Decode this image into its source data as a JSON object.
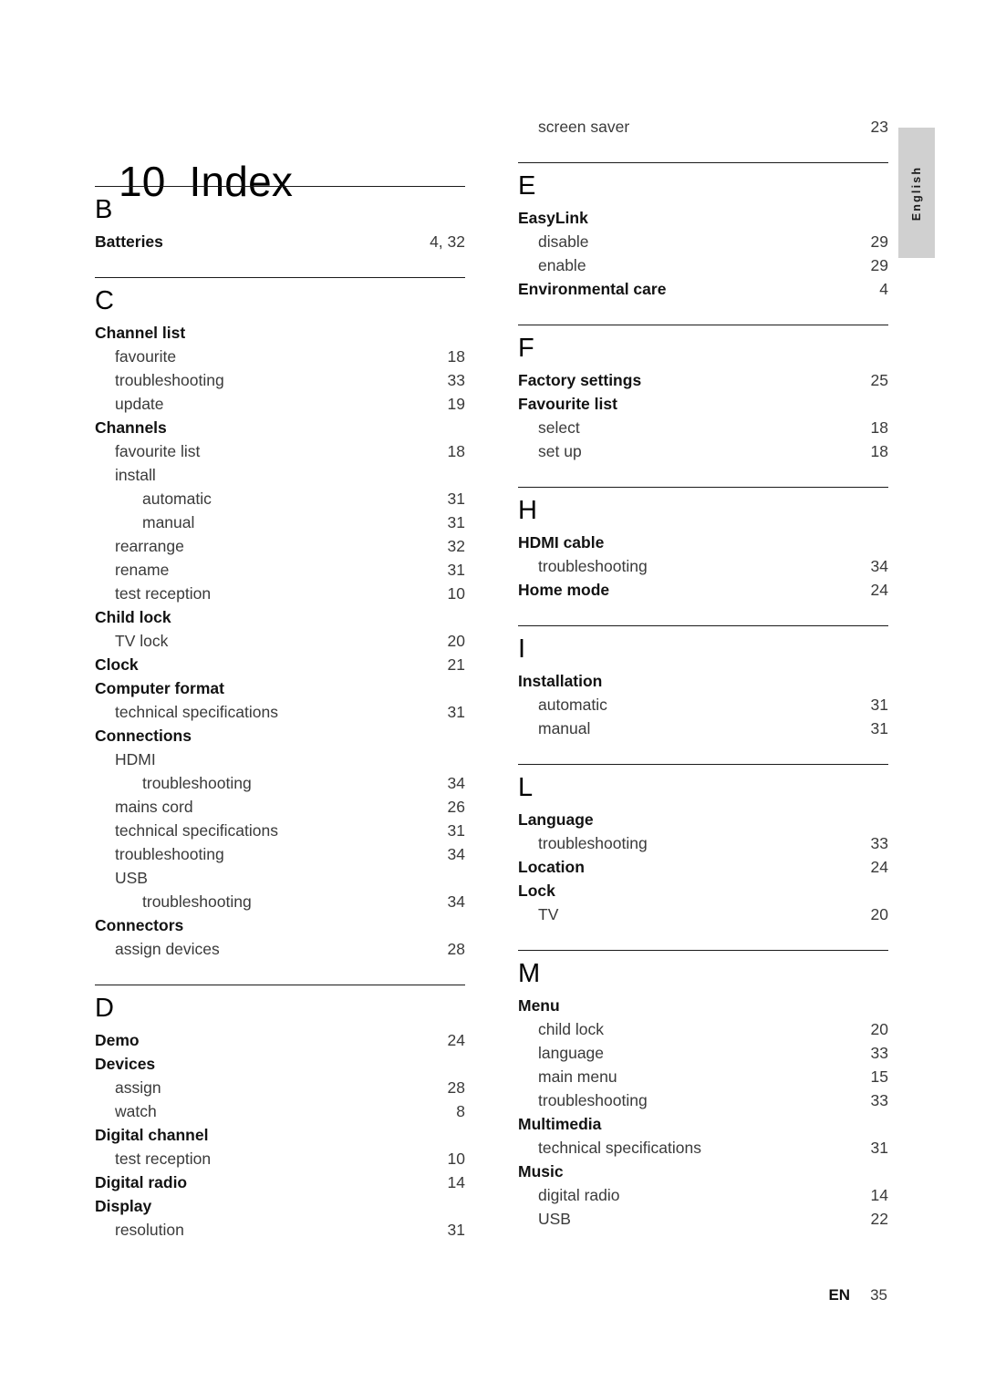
{
  "title": {
    "number": "10",
    "text": "Index"
  },
  "side_tab": {
    "label": "English"
  },
  "footer": {
    "language_code": "EN",
    "page_number": "35"
  },
  "columns": [
    {
      "name": "left-column",
      "sections": [
        {
          "letter": "B",
          "entries": [
            {
              "label": "Batteries",
              "page": "4, 32",
              "level": 0
            }
          ]
        },
        {
          "letter": "C",
          "entries": [
            {
              "label": "Channel list",
              "page": "",
              "level": 0
            },
            {
              "label": "favourite",
              "page": "18",
              "level": 1
            },
            {
              "label": "troubleshooting",
              "page": "33",
              "level": 1
            },
            {
              "label": "update",
              "page": "19",
              "level": 1
            },
            {
              "label": "Channels",
              "page": "",
              "level": 0
            },
            {
              "label": "favourite list",
              "page": "18",
              "level": 1
            },
            {
              "label": "install",
              "page": "",
              "level": 1
            },
            {
              "label": "automatic",
              "page": "31",
              "level": 2
            },
            {
              "label": "manual",
              "page": "31",
              "level": 2
            },
            {
              "label": "rearrange",
              "page": "32",
              "level": 1
            },
            {
              "label": "rename",
              "page": "31",
              "level": 1
            },
            {
              "label": "test reception",
              "page": "10",
              "level": 1
            },
            {
              "label": "Child lock",
              "page": "",
              "level": 0
            },
            {
              "label": "TV lock",
              "page": "20",
              "level": 1
            },
            {
              "label": "Clock",
              "page": "21",
              "level": 0
            },
            {
              "label": "Computer format",
              "page": "",
              "level": 0
            },
            {
              "label": "technical specifications",
              "page": "31",
              "level": 1
            },
            {
              "label": "Connections",
              "page": "",
              "level": 0
            },
            {
              "label": "HDMI",
              "page": "",
              "level": 1
            },
            {
              "label": "troubleshooting",
              "page": "34",
              "level": 2
            },
            {
              "label": "mains cord",
              "page": "26",
              "level": 1
            },
            {
              "label": "technical specifications",
              "page": "31",
              "level": 1
            },
            {
              "label": "troubleshooting",
              "page": "34",
              "level": 1
            },
            {
              "label": "USB",
              "page": "",
              "level": 1
            },
            {
              "label": "troubleshooting",
              "page": "34",
              "level": 2
            },
            {
              "label": "Connectors",
              "page": "",
              "level": 0
            },
            {
              "label": "assign devices",
              "page": "28",
              "level": 1
            }
          ]
        },
        {
          "letter": "D",
          "entries": [
            {
              "label": "Demo",
              "page": "24",
              "level": 0
            },
            {
              "label": "Devices",
              "page": "",
              "level": 0
            },
            {
              "label": "assign",
              "page": "28",
              "level": 1
            },
            {
              "label": "watch",
              "page": "8",
              "level": 1
            },
            {
              "label": "Digital channel",
              "page": "",
              "level": 0
            },
            {
              "label": "test reception",
              "page": "10",
              "level": 1
            },
            {
              "label": "Digital radio",
              "page": "14",
              "level": 0
            },
            {
              "label": "Display",
              "page": "",
              "level": 0
            },
            {
              "label": "resolution",
              "page": "31",
              "level": 1
            }
          ]
        }
      ]
    },
    {
      "name": "right-column",
      "sections": [
        {
          "letter": "",
          "entries": [
            {
              "label": "screen saver",
              "page": "23",
              "level": 1
            }
          ]
        },
        {
          "letter": "E",
          "entries": [
            {
              "label": "EasyLink",
              "page": "",
              "level": 0
            },
            {
              "label": "disable",
              "page": "29",
              "level": 1
            },
            {
              "label": "enable",
              "page": "29",
              "level": 1
            },
            {
              "label": "Environmental care",
              "page": "4",
              "level": 0
            }
          ]
        },
        {
          "letter": "F",
          "entries": [
            {
              "label": "Factory settings",
              "page": "25",
              "level": 0
            },
            {
              "label": "Favourite list",
              "page": "",
              "level": 0
            },
            {
              "label": "select",
              "page": "18",
              "level": 1
            },
            {
              "label": "set up",
              "page": "18",
              "level": 1
            }
          ]
        },
        {
          "letter": "H",
          "entries": [
            {
              "label": "HDMI cable",
              "page": "",
              "level": 0
            },
            {
              "label": "troubleshooting",
              "page": "34",
              "level": 1
            },
            {
              "label": "Home mode",
              "page": "24",
              "level": 0
            }
          ]
        },
        {
          "letter": "I",
          "entries": [
            {
              "label": "Installation",
              "page": "",
              "level": 0
            },
            {
              "label": "automatic",
              "page": "31",
              "level": 1
            },
            {
              "label": "manual",
              "page": "31",
              "level": 1
            }
          ]
        },
        {
          "letter": "L",
          "entries": [
            {
              "label": "Language",
              "page": "",
              "level": 0
            },
            {
              "label": "troubleshooting",
              "page": "33",
              "level": 1
            },
            {
              "label": "Location",
              "page": "24",
              "level": 0
            },
            {
              "label": "Lock",
              "page": "",
              "level": 0
            },
            {
              "label": "TV",
              "page": "20",
              "level": 1
            }
          ]
        },
        {
          "letter": "M",
          "entries": [
            {
              "label": "Menu",
              "page": "",
              "level": 0
            },
            {
              "label": "child lock",
              "page": "20",
              "level": 1
            },
            {
              "label": "language",
              "page": "33",
              "level": 1
            },
            {
              "label": "main menu",
              "page": "15",
              "level": 1
            },
            {
              "label": "troubleshooting",
              "page": "33",
              "level": 1
            },
            {
              "label": "Multimedia",
              "page": "",
              "level": 0
            },
            {
              "label": "technical specifications",
              "page": "31",
              "level": 1
            },
            {
              "label": "Music",
              "page": "",
              "level": 0
            },
            {
              "label": "digital radio",
              "page": "14",
              "level": 1
            },
            {
              "label": "USB",
              "page": "22",
              "level": 1
            }
          ]
        }
      ]
    }
  ]
}
